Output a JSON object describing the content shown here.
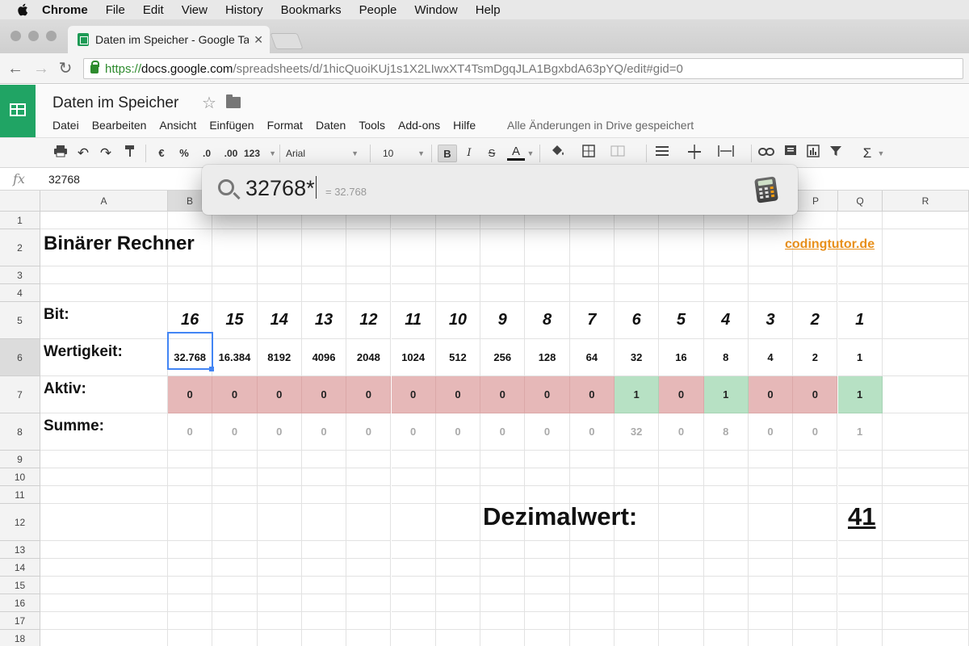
{
  "menubar": {
    "app": "Chrome",
    "items": [
      "File",
      "Edit",
      "View",
      "History",
      "Bookmarks",
      "People",
      "Window",
      "Help"
    ]
  },
  "browser": {
    "tab_title": "Daten im Speicher - Google Ta",
    "url_scheme": "https://",
    "url_host": "docs.google.com",
    "url_path": "/spreadsheets/d/1hicQuoiKUj1s1X2LIwxXT4TsmDgqJLA1BgxbdA63pYQ/edit#gid=0"
  },
  "doc": {
    "title": "Daten im Speicher",
    "menu": [
      "Datei",
      "Bearbeiten",
      "Ansicht",
      "Einfügen",
      "Format",
      "Daten",
      "Tools",
      "Add-ons",
      "Hilfe"
    ],
    "save_status": "Alle Änderungen in Drive gespeichert"
  },
  "toolbar": {
    "currency": "€",
    "percent": "%",
    "dec_less": ".0",
    "dec_more": ".00",
    "number_format": "123",
    "font": "Arial",
    "font_size": "10",
    "bold": "B",
    "italic": "I",
    "strike": "S",
    "text_color": "A",
    "sigma": "Σ"
  },
  "formula_bar": {
    "fx": "fx",
    "value": "32768"
  },
  "grid": {
    "col_headers": [
      "A",
      "B",
      "P",
      "Q",
      "R"
    ],
    "row_numbers": [
      "1",
      "2",
      "3",
      "4",
      "5",
      "6",
      "7",
      "8",
      "9",
      "10",
      "11",
      "12",
      "13",
      "14",
      "15",
      "16",
      "17",
      "18"
    ],
    "title": "Binärer Rechner",
    "link": "codingtutor.de",
    "row_labels": {
      "bit": "Bit:",
      "wertigkeit": "Wertigkeit:",
      "aktiv": "Aktiv:",
      "summe": "Summe:"
    },
    "bits": [
      "16",
      "15",
      "14",
      "13",
      "12",
      "11",
      "10",
      "9",
      "8",
      "7",
      "6",
      "5",
      "4",
      "3",
      "2",
      "1"
    ],
    "wertigkeit": [
      "32.768",
      "16.384",
      "8192",
      "4096",
      "2048",
      "1024",
      "512",
      "256",
      "128",
      "64",
      "32",
      "16",
      "8",
      "4",
      "2",
      "1"
    ],
    "aktiv": [
      "0",
      "0",
      "0",
      "0",
      "0",
      "0",
      "0",
      "0",
      "0",
      "0",
      "1",
      "0",
      "1",
      "0",
      "0",
      "1"
    ],
    "summe": [
      "0",
      "0",
      "0",
      "0",
      "0",
      "0",
      "0",
      "0",
      "0",
      "0",
      "32",
      "0",
      "8",
      "0",
      "0",
      "1"
    ],
    "dezimal_label": "Dezimalwert:",
    "dezimal_value": "41"
  },
  "spotlight": {
    "query": "32768*",
    "result": "= 32.768",
    "icon": "calculator-icon"
  },
  "colors": {
    "sheets_green": "#20a464",
    "active_off": "#e6b8b8",
    "active_on": "#b7e1c4",
    "link_orange": "#e8901c",
    "selection_blue": "#4285f4"
  }
}
